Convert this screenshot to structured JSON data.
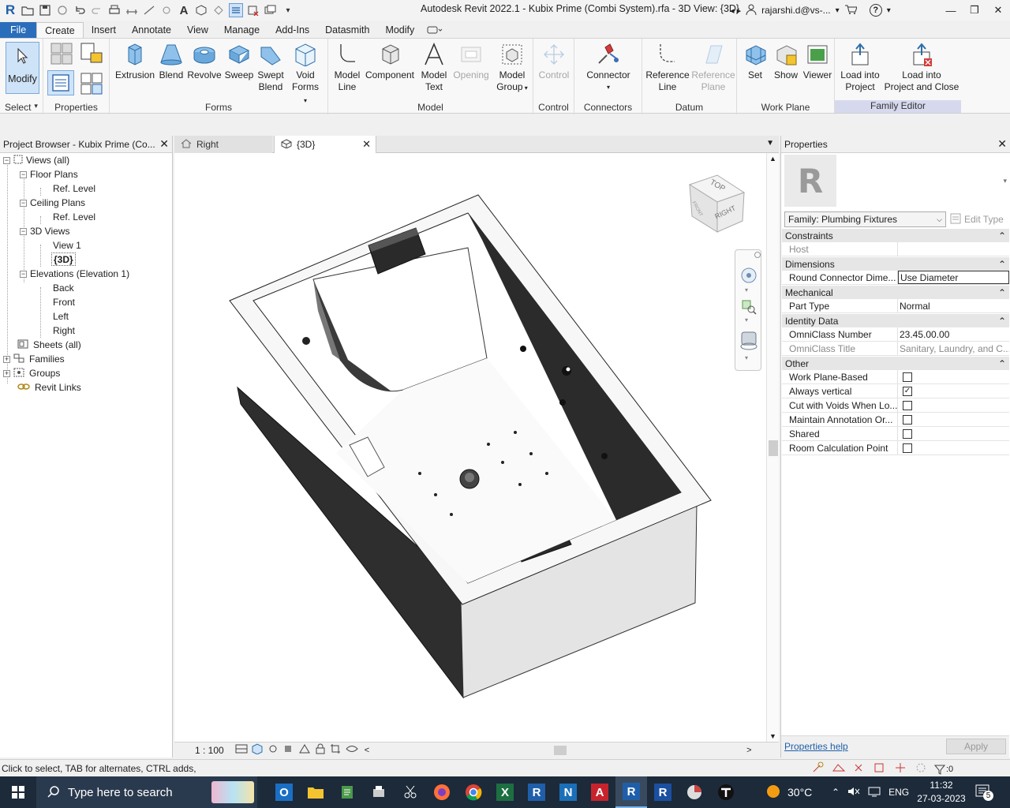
{
  "title_bar": {
    "app_title": "Autodesk Revit 2022.1 - Kubix Prime (Combi System).rfa - 3D View: {3D}",
    "user": "rajarshi.d@vs-...",
    "app_logo": "R"
  },
  "ribbon_tabs": [
    "File",
    "Create",
    "Insert",
    "Annotate",
    "View",
    "Manage",
    "Add-Ins",
    "Datasmith",
    "Modify"
  ],
  "ribbon": {
    "select": {
      "modify_label": "Modify",
      "panel_label": "Select"
    },
    "properties": {
      "panel_label": "Properties"
    },
    "forms": {
      "panel_label": "Forms",
      "extrusion": "Extrusion",
      "blend": "Blend",
      "revolve": "Revolve",
      "sweep": "Sweep",
      "swept_blend_1": "Swept",
      "swept_blend_2": "Blend",
      "void_1": "Void",
      "void_2": "Forms"
    },
    "model": {
      "panel_label": "Model",
      "model_line_1": "Model",
      "model_line_2": "Line",
      "component": "Component",
      "model_text_1": "Model",
      "model_text_2": "Text",
      "opening": "Opening",
      "model_group_1": "Model",
      "model_group_2": "Group"
    },
    "control": {
      "panel_label": "Control",
      "control": "Control"
    },
    "connectors": {
      "panel_label": "Connectors",
      "connector": "Connector"
    },
    "datum": {
      "panel_label": "Datum",
      "ref_line_1": "Reference",
      "ref_line_2": "Line",
      "ref_plane_1": "Reference",
      "ref_plane_2": "Plane"
    },
    "work_plane": {
      "panel_label": "Work Plane",
      "set": "Set",
      "show": "Show",
      "viewer": "Viewer"
    },
    "family_editor": {
      "panel_label": "Family Editor",
      "load_into_project_1": "Load into",
      "load_into_project_2": "Project",
      "load_close_1": "Load into",
      "load_close_2": "Project and Close"
    }
  },
  "project_browser": {
    "title": "Project Browser - Kubix Prime (Co...",
    "tree": {
      "views_all": "Views (all)",
      "floor_plans": "Floor Plans",
      "fp_ref_level": "Ref. Level",
      "ceiling_plans": "Ceiling Plans",
      "cp_ref_level": "Ref. Level",
      "views_3d": "3D Views",
      "view1": "View 1",
      "view_3d": "{3D}",
      "elevations": "Elevations (Elevation 1)",
      "back": "Back",
      "front": "Front",
      "left": "Left",
      "right": "Right",
      "sheets": "Sheets (all)",
      "families": "Families",
      "groups": "Groups",
      "revit_links": "Revit Links"
    }
  },
  "view_tabs": [
    {
      "label": "Right"
    },
    {
      "label": "{3D}"
    }
  ],
  "viewcube": {
    "top": "TOP",
    "right": "RIGHT",
    "front": "FRONT"
  },
  "view_bar": {
    "scale": "1 : 100"
  },
  "properties": {
    "title": "Properties",
    "type_selector": "Family: Plumbing Fixtures",
    "edit_type": "Edit Type",
    "groups": {
      "constraints": "Constraints",
      "dimensions": "Dimensions",
      "mechanical": "Mechanical",
      "identity": "Identity Data",
      "other": "Other"
    },
    "rows": {
      "host_k": "Host",
      "host_v": "",
      "rcd_k": "Round Connector Dime...",
      "rcd_v": "Use Diameter",
      "part_type_k": "Part Type",
      "part_type_v": "Normal",
      "omni_num_k": "OmniClass Number",
      "omni_num_v": "23.45.00.00",
      "omni_title_k": "OmniClass Title",
      "omni_title_v": "Sanitary, Laundry, and C...",
      "wpb_k": "Work Plane-Based",
      "always_vertical_k": "Always vertical",
      "cut_voids_k": "Cut with Voids When Lo...",
      "maintain_k": "Maintain Annotation Or...",
      "shared_k": "Shared",
      "room_calc_k": "Room Calculation Point"
    },
    "help": "Properties help",
    "apply": "Apply"
  },
  "status_bar": {
    "text": "Click to select, TAB for alternates, CTRL adds, Sh",
    "filter_count": ":0"
  },
  "taskbar": {
    "search_placeholder": "Type here to search",
    "temperature": "30°C",
    "lang": "ENG",
    "time": "11:32",
    "date": "27-03-2023",
    "notifications": "5"
  },
  "colors": {
    "file_tab": "#2a6ebb",
    "taskbar": "#1c2a3a",
    "family_editor_panel": "#d6d9ee"
  }
}
